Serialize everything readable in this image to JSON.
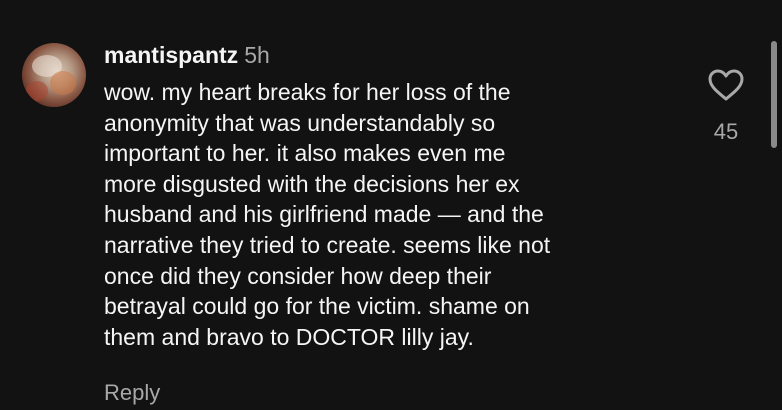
{
  "comment": {
    "username": "mantispantz",
    "time": "5h",
    "lines": [
      "wow. my heart breaks for her loss of the",
      "anonymity that was understandably so",
      "important to her. it also makes even me",
      "more disgusted with the decisions her ex",
      "husband and his girlfriend made — and the",
      "narrative they tried to create. seems like not",
      "once did they consider how deep their",
      "betrayal could go for the victim. shame on",
      "them and bravo to DOCTOR lilly jay."
    ],
    "reply_label": "Reply",
    "like_count": "45",
    "icons": {
      "like": "heart-outline-icon"
    }
  },
  "colors": {
    "background": "#121212",
    "primary_text": "#f5f5f5",
    "secondary_text": "#a8a8a8"
  }
}
